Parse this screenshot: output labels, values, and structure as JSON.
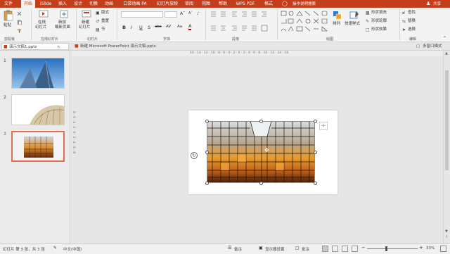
{
  "tabs": [
    {
      "label": "文件"
    },
    {
      "label": "开始"
    },
    {
      "label": "iSlide"
    },
    {
      "label": "插入"
    },
    {
      "label": "设计"
    },
    {
      "label": "切换"
    },
    {
      "label": "动画"
    },
    {
      "label": "口袋动画 PA"
    },
    {
      "label": "幻灯片放映"
    },
    {
      "label": "审阅"
    },
    {
      "label": "视图"
    },
    {
      "label": "帮助"
    },
    {
      "label": "WPS PDF"
    },
    {
      "label": "格式"
    }
  ],
  "search": {
    "label": "操作说明搜索"
  },
  "share": {
    "label": "共享"
  },
  "ribbon": {
    "clipboard": {
      "paste": "粘贴",
      "group": "剪贴板"
    },
    "online": {
      "play_line1": "在线",
      "play_line2": "幻灯片",
      "add_line1": "新加",
      "add_line2": "载新页面",
      "group": "在线幻灯片"
    },
    "slides": {
      "new_line1": "新建",
      "new_line2": "幻灯片",
      "layout": "版式",
      "reset": "重置",
      "section": "节",
      "group": "幻灯片"
    },
    "font": {
      "group": "字体",
      "bold": "B",
      "italic": "I",
      "underline": "U",
      "shadow": "S",
      "strike": "abc",
      "spacing": "AV",
      "case": "Aa",
      "color": "A"
    },
    "paragraph": {
      "group": "段落"
    },
    "drawing": {
      "arrange": "排列",
      "quick_styles": "快速样式",
      "fill": "形状填充",
      "outline": "形状轮廓",
      "effect": "形状效果",
      "group": "绘图"
    },
    "editing": {
      "find": "查找",
      "replace": "替换",
      "select": "选择",
      "group": "编辑"
    }
  },
  "doc_tabs": [
    {
      "label": "演示文稿1.pptx"
    },
    {
      "label": "新建 Microsoft PowerPoint 演示文稿.pptx"
    }
  ],
  "window_mode": {
    "label": "多窗口模式"
  },
  "ruler": {
    "top": "16 · 14 · 12 · 10 · 8 · 6 · 4 · 2 · 0 · 2 · 4 · 6 · 8 · 10 · 12 · 14 · 16",
    "side": "8 · 6 · 4 · 2 · 0 · 2 · 4 · 6 · 8"
  },
  "slides": [
    {
      "number": "1"
    },
    {
      "number": "2"
    },
    {
      "number": "3"
    }
  ],
  "status": {
    "slide_info": "幻灯片 第 3 张，共 3 张",
    "language": "中文(中国)",
    "notes": "备注",
    "display_settings": "显示器设置",
    "comments": "批注",
    "zoom": "33%"
  },
  "colors": {
    "accent": "#c43e1c",
    "selected_thumb": "#e07050"
  }
}
